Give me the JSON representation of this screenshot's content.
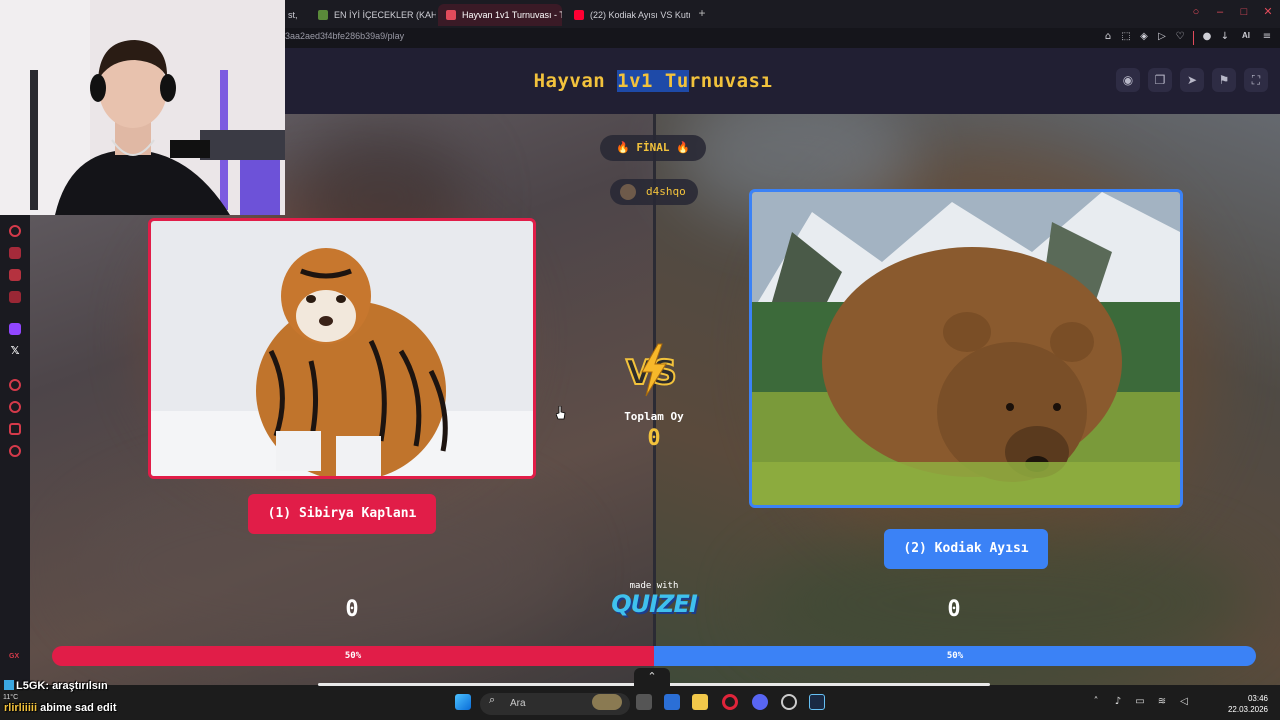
{
  "browser": {
    "tabs": [
      {
        "label": "st, ",
        "active": false
      },
      {
        "label": "EN İYİ İÇECEKLER (KAHVE",
        "active": false
      },
      {
        "label": "Hayvan 1v1 Turnuvası - Tı",
        "active": true
      },
      {
        "label": "(22) Kodiak Ayısı VS Kutup",
        "active": false
      }
    ],
    "url": "3aa2aed3f4bfe286b39a9/play",
    "ai_label": "AI"
  },
  "quiz": {
    "title_pre": "Hayvan ",
    "title_hl": "1v1 Tu",
    "title_post": "rnuvası",
    "round": "🔥 FİNAL 🔥",
    "user": "d4shqo",
    "option_left": "(1) Sibirya Kaplanı",
    "option_right": "(2) Kodiak Ayısı",
    "total_label": "Toplam Oy",
    "total_votes": "0",
    "score_left": "0",
    "score_right": "0",
    "made_with": "made with",
    "brand": "QUIZEI",
    "percent_left": 50,
    "percent_right": 50,
    "percent_left_label": "50%",
    "percent_right_label": "50%"
  },
  "taskbar": {
    "search_placeholder": "Ara",
    "time": "03:46",
    "date": "22.03.2026",
    "weather_temp": "11°C"
  },
  "overlay": {
    "chat_user1": "L5GK",
    "chat_text1": ": araştırılsın",
    "chat_user2": "rlirliiiii",
    "chat_text2": "abime sad edit"
  },
  "colors": {
    "accent_red": "#e11d48",
    "accent_blue": "#3b82f6",
    "title_gold": "#f2c23c",
    "header_bg": "#211f33"
  }
}
